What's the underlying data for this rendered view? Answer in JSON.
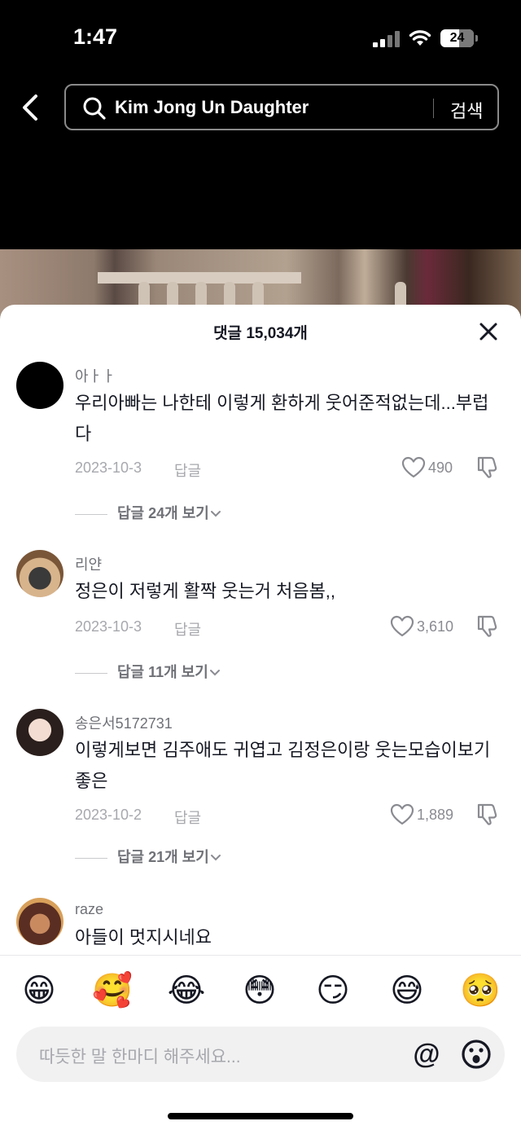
{
  "status_bar": {
    "time": "1:47",
    "battery": "24"
  },
  "search": {
    "query": "Kim Jong Un Daughter",
    "button_label": "검색"
  },
  "comments_sheet": {
    "title": "댓글 15,034개",
    "comments": [
      {
        "username": "아ㅏㅏ",
        "text": "우리아빠는 나한테 이렇게 환하게 웃어준적없는데...부럽다",
        "date": "2023-10-3",
        "reply_label": "답글",
        "likes": "490",
        "view_replies": "답글 24개 보기"
      },
      {
        "username": "리얀",
        "text": "정은이 저렇게 활짝 웃는거 처음봄,,",
        "date": "2023-10-3",
        "reply_label": "답글",
        "likes": "3,610",
        "view_replies": "답글 11개 보기"
      },
      {
        "username": "송은서5172731",
        "text": "이렇게보면 김주애도 귀엽고 김정은이랑 웃는모습이보기좋은",
        "date": "2023-10-2",
        "reply_label": "답글",
        "likes": "1,889",
        "view_replies": "답글 21개 보기"
      },
      {
        "username": "raze",
        "text": "아들이 멋지시네요"
      }
    ]
  },
  "emoji_row": [
    "😁",
    "🥰",
    "😂",
    "😳",
    "😏",
    "😅",
    "🥺"
  ],
  "composer": {
    "placeholder": "따듯한 말 한마디 해주세요..."
  }
}
